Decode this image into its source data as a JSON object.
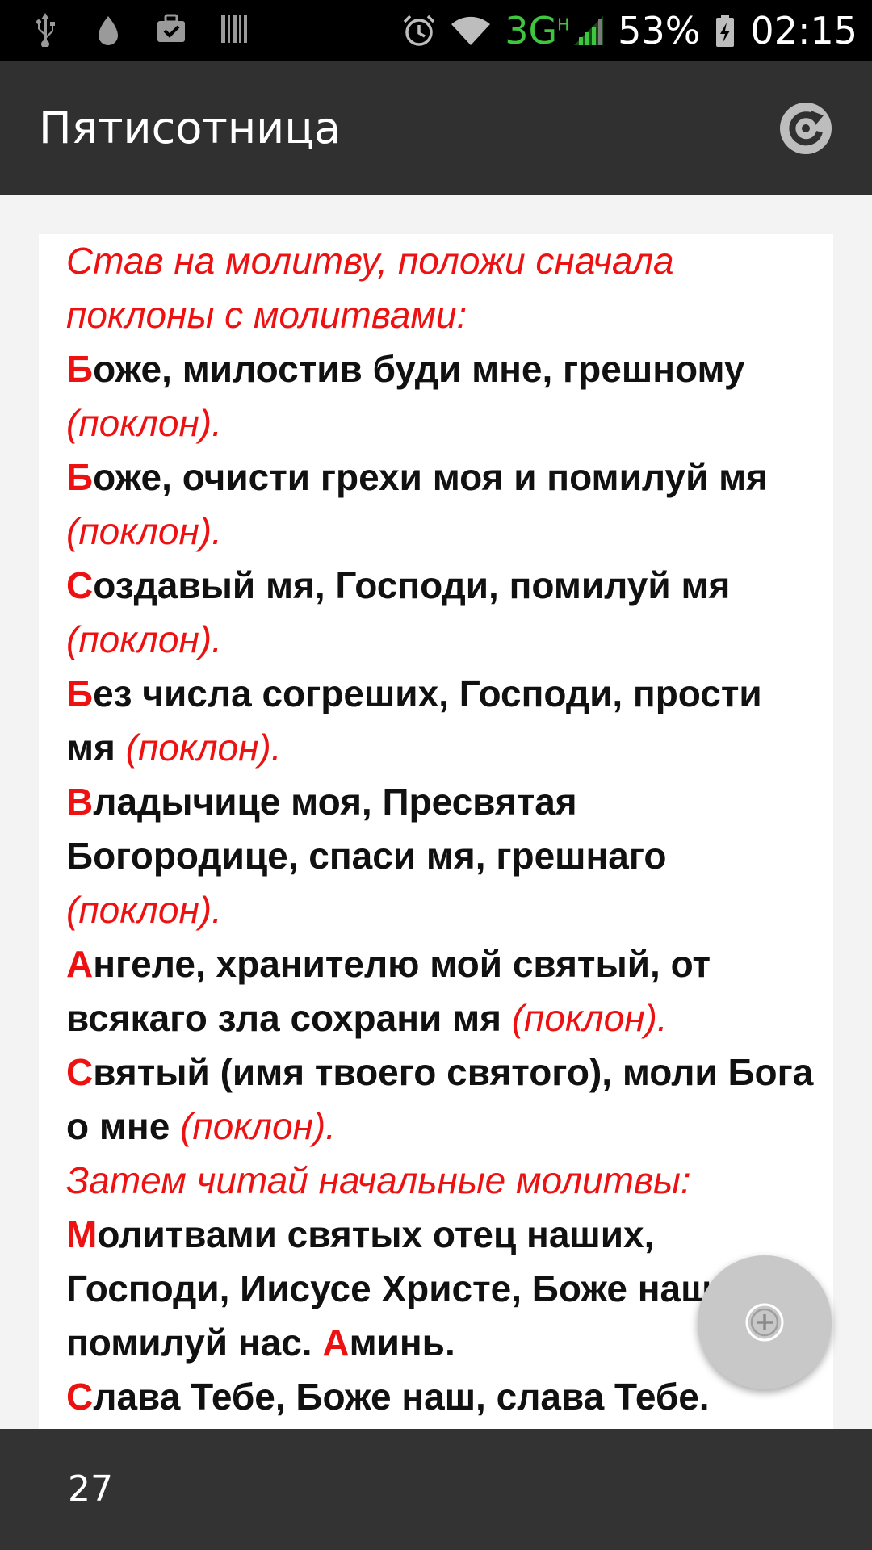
{
  "status_bar": {
    "icons_left": [
      "usb-icon",
      "drop-icon",
      "briefcase-check-icon",
      "barcode-icon"
    ],
    "icons_right": [
      "alarm-icon",
      "wifi-icon",
      "signal-icon",
      "battery-charging-icon"
    ],
    "network_type": "3G",
    "network_sub": "H",
    "battery": "53%",
    "time": "02:15"
  },
  "app_bar": {
    "title": "Пятисотница",
    "action_icon": "refresh-icon"
  },
  "content": {
    "paragraphs": [
      {
        "type": "instruction",
        "text": "Став на молитву, положи сначала поклоны с молитвами:"
      },
      {
        "type": "prayer",
        "cap": "Б",
        "text": "оже, милостив буди мне, грешному",
        "note": "(поклон)."
      },
      {
        "type": "prayer",
        "cap": "Б",
        "text": "оже, очисти грехи моя и помилуй мя",
        "note": "(поклон)."
      },
      {
        "type": "prayer",
        "cap": "С",
        "text": "оздавый мя, Господи, помилуй мя",
        "note": "(поклон)."
      },
      {
        "type": "prayer",
        "cap": "Б",
        "text": "ез числа согреших, Господи, прости мя",
        "note": "(поклон)."
      },
      {
        "type": "prayer",
        "cap": "В",
        "text": "ладычице моя, Пресвятая Богородице, спаси мя, грешнаго",
        "note": "(поклон)."
      },
      {
        "type": "prayer",
        "cap": "А",
        "text": "нгеле, хранителю мой святый, от всякаго зла сохрани мя",
        "note": "(поклон)."
      },
      {
        "type": "prayer",
        "cap": "С",
        "text": "вятый (имя твоего святого), моли Бога о мне",
        "note": "(поклон)."
      },
      {
        "type": "instruction",
        "text": "Затем читай начальные молитвы:"
      },
      {
        "type": "prayer",
        "cap": "М",
        "text": "олитвами святых отец наших, Господи, Иисусе Христе, Боже наш, помилуй нас.",
        "cap2": "А",
        "text2": "минь."
      },
      {
        "type": "prayer",
        "cap": "С",
        "text": "лава Тебе, Боже наш, слава Тебе."
      }
    ]
  },
  "fab": {
    "icon": "add-circle-icon"
  },
  "bottom_bar": {
    "page_number": "27"
  },
  "colors": {
    "accent_red": "#ee1111",
    "app_bar": "#303030",
    "bottom_bar": "#333333",
    "network_green": "#3fc63f"
  }
}
